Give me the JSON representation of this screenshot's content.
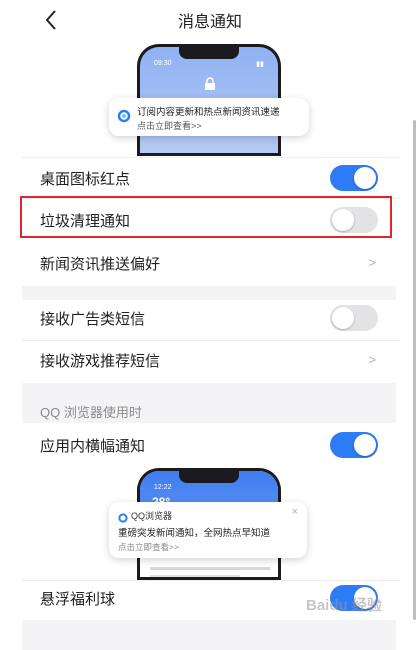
{
  "header": {
    "title": "消息通知"
  },
  "preview1": {
    "status_time": "09:30",
    "notification_line1": "订阅内容更新和热点新闻资讯速递",
    "notification_line2": "点击立即查看>>"
  },
  "settings": {
    "desktop_badge": {
      "label": "桌面图标红点",
      "enabled": true
    },
    "junk_clean": {
      "label": "垃圾清理通知",
      "enabled": false,
      "highlight_color": "#e0262d"
    },
    "news_pref": {
      "label": "新闻资讯推送偏好"
    },
    "ad_sms": {
      "label": "接收广告类短信",
      "enabled": false
    },
    "game_sms": {
      "label": "接收游戏推荐短信"
    }
  },
  "section2": {
    "title": "QQ 浏览器使用时",
    "banner": {
      "label": "应用内横幅通知",
      "enabled": true
    },
    "float_ball": {
      "label": "悬浮福利球",
      "enabled": true
    }
  },
  "preview2": {
    "status_time": "12:22",
    "temperature": "28°",
    "app_name": "QQ浏览器",
    "notification_line1": "重磅突发新闻通知，全网热点早知道",
    "notification_line2": "点击立即查看>>",
    "close_label": "×"
  },
  "watermark": {
    "text": "Baidu 经验"
  },
  "colors": {
    "accent": "#2d7cf6",
    "toggle_off": "#e3e3e6",
    "highlight": "#e0262d"
  }
}
